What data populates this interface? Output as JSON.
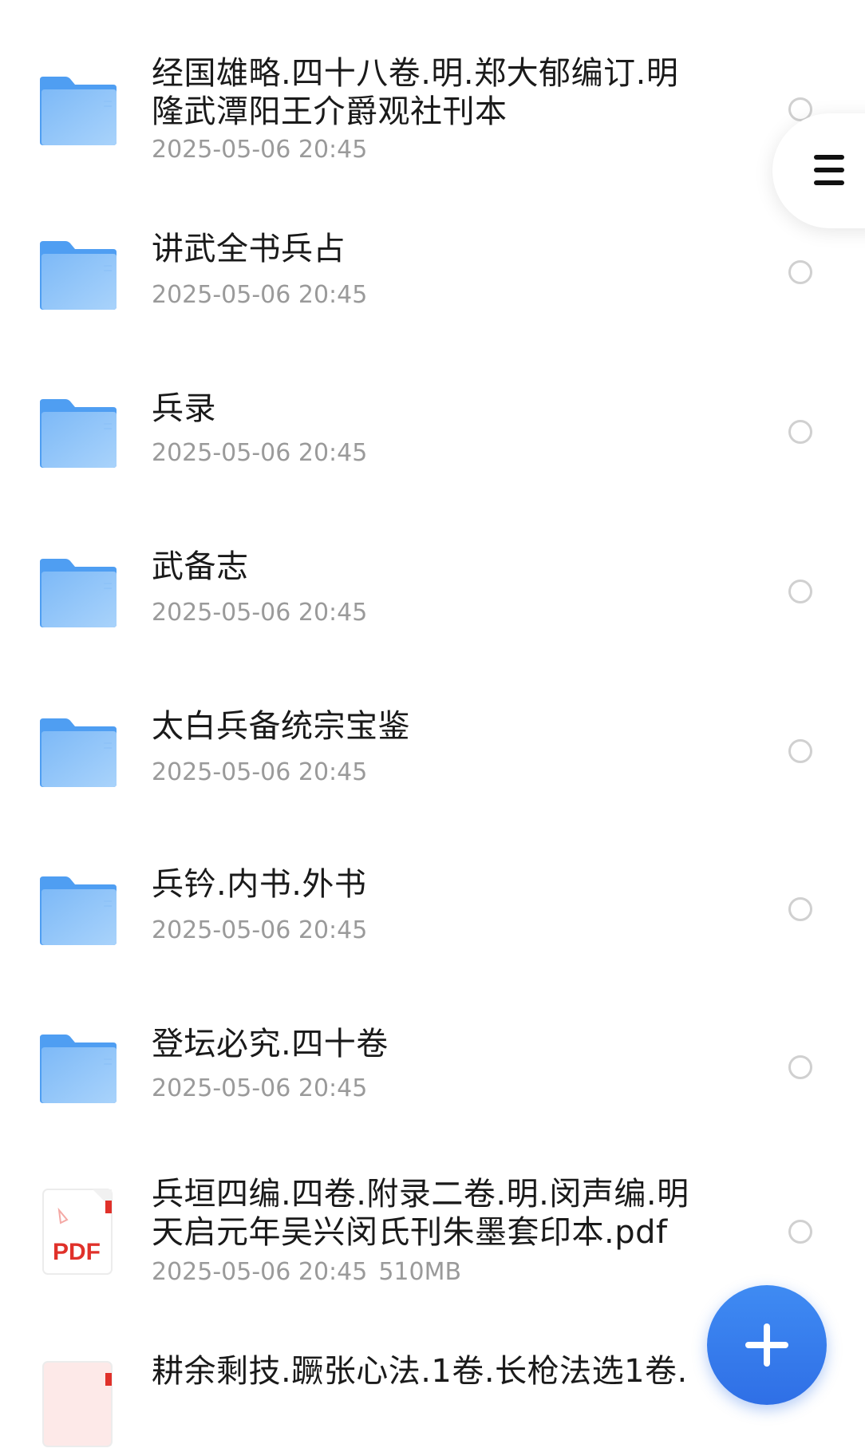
{
  "files": [
    {
      "name_lines": [
        "经国雄略.四十八卷.明.郑大郁编订.明",
        "隆武潭阳王介爵观社刊本"
      ],
      "date": "2025-05-06 20:45",
      "size": "",
      "type": "folder"
    },
    {
      "name_lines": [
        "讲武全书兵占"
      ],
      "date": "2025-05-06 20:45",
      "size": "",
      "type": "folder"
    },
    {
      "name_lines": [
        "兵录"
      ],
      "date": "2025-05-06 20:45",
      "size": "",
      "type": "folder"
    },
    {
      "name_lines": [
        "武备志"
      ],
      "date": "2025-05-06 20:45",
      "size": "",
      "type": "folder"
    },
    {
      "name_lines": [
        "太白兵备统宗宝鉴"
      ],
      "date": "2025-05-06 20:45",
      "size": "",
      "type": "folder"
    },
    {
      "name_lines": [
        "兵钤.内书.外书"
      ],
      "date": "2025-05-06 20:45",
      "size": "",
      "type": "folder"
    },
    {
      "name_lines": [
        "登坛必究.四十卷"
      ],
      "date": "2025-05-06 20:45",
      "size": "",
      "type": "folder"
    },
    {
      "name_lines": [
        "兵垣四编.四卷.附录二卷.明.闵声编.明",
        "天启元年吴兴闵氏刊朱墨套印本.pdf"
      ],
      "date": "2025-05-06 20:45",
      "size": "510MB",
      "type": "pdf"
    },
    {
      "name_lines": [
        "耕余剩技.蹶张心法.1卷.长枪法选1卷."
      ],
      "date": "",
      "size": "",
      "type": "pdf"
    }
  ],
  "pdf_badge": "PDF",
  "icons": {
    "folder": "folder-icon",
    "pdf": "pdf-file-icon",
    "select": "radio-unchecked-icon",
    "menu": "hamburger-menu-icon",
    "add": "plus-icon"
  },
  "colors": {
    "accent": "#2f6fe6",
    "folder": "#6fb3f6",
    "pdf_red": "#e0312a",
    "meta_text": "#9a9a9a"
  }
}
